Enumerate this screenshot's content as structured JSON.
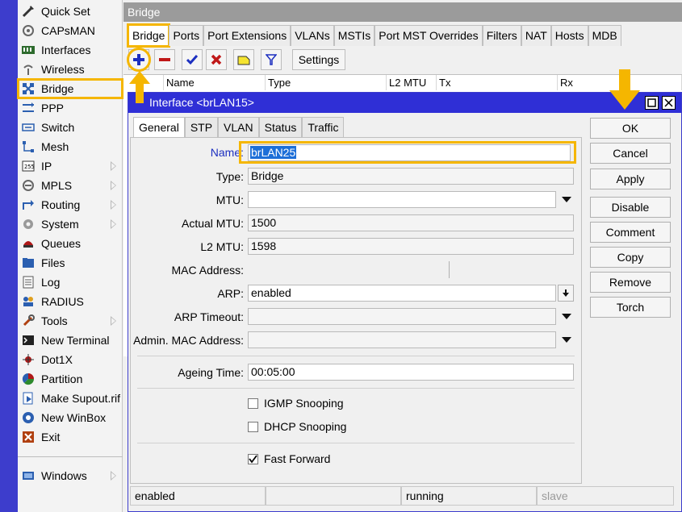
{
  "sidebar": {
    "items": [
      {
        "label": "Quick Set",
        "icon": "wand-icon",
        "submenu": false
      },
      {
        "label": "CAPsMAN",
        "icon": "capsman-icon",
        "submenu": false
      },
      {
        "label": "Interfaces",
        "icon": "interfaces-icon",
        "submenu": false
      },
      {
        "label": "Wireless",
        "icon": "wireless-icon",
        "submenu": false
      },
      {
        "label": "Bridge",
        "icon": "bridge-icon",
        "submenu": false,
        "selected": true
      },
      {
        "label": "PPP",
        "icon": "ppp-icon",
        "submenu": false
      },
      {
        "label": "Switch",
        "icon": "switch-icon",
        "submenu": false
      },
      {
        "label": "Mesh",
        "icon": "mesh-icon",
        "submenu": false
      },
      {
        "label": "IP",
        "icon": "ip-icon",
        "submenu": true
      },
      {
        "label": "MPLS",
        "icon": "mpls-icon",
        "submenu": true
      },
      {
        "label": "Routing",
        "icon": "routing-icon",
        "submenu": true
      },
      {
        "label": "System",
        "icon": "system-gear-icon",
        "submenu": true
      },
      {
        "label": "Queues",
        "icon": "queues-icon",
        "submenu": false
      },
      {
        "label": "Files",
        "icon": "folder-icon",
        "submenu": false
      },
      {
        "label": "Log",
        "icon": "log-icon",
        "submenu": false
      },
      {
        "label": "RADIUS",
        "icon": "radius-icon",
        "submenu": false
      },
      {
        "label": "Tools",
        "icon": "tools-icon",
        "submenu": true
      },
      {
        "label": "New Terminal",
        "icon": "terminal-icon",
        "submenu": false
      },
      {
        "label": "Dot1X",
        "icon": "dot1x-icon",
        "submenu": false
      },
      {
        "label": "Partition",
        "icon": "partition-icon",
        "submenu": false
      },
      {
        "label": "Make Supout.rif",
        "icon": "supout-icon",
        "submenu": false
      },
      {
        "label": "New WinBox",
        "icon": "winbox-icon",
        "submenu": false
      },
      {
        "label": "Exit",
        "icon": "exit-icon",
        "submenu": false
      }
    ],
    "windows": {
      "label": "Windows",
      "icon": "windows-icon",
      "submenu": true
    }
  },
  "bridge_window": {
    "title": "Bridge",
    "tabs": [
      "Bridge",
      "Ports",
      "Port Extensions",
      "VLANs",
      "MSTIs",
      "Port MST Overrides",
      "Filters",
      "NAT",
      "Hosts",
      "MDB"
    ],
    "toolbar": {
      "settings_label": "Settings"
    },
    "columns": [
      "Name",
      "Type",
      "L2 MTU",
      "Tx",
      "Rx"
    ]
  },
  "dialog": {
    "title": "Interface <brLAN15>",
    "tabs": [
      "General",
      "STP",
      "VLAN",
      "Status",
      "Traffic"
    ],
    "fields": {
      "name_label": "Name:",
      "name_value": "brLAN25",
      "type_label": "Type:",
      "type_value": "Bridge",
      "mtu_label": "MTU:",
      "mtu_value": "",
      "actual_mtu_label": "Actual MTU:",
      "actual_mtu_value": "1500",
      "l2_mtu_label": "L2 MTU:",
      "l2_mtu_value": "1598",
      "mac_label": "MAC Address:",
      "mac_value": "",
      "arp_label": "ARP:",
      "arp_value": "enabled",
      "arp_timeout_label": "ARP Timeout:",
      "arp_timeout_value": "",
      "admin_mac_label": "Admin. MAC Address:",
      "admin_mac_value": "",
      "ageing_label": "Ageing Time:",
      "ageing_value": "00:05:00"
    },
    "checkboxes": {
      "igmp": {
        "label": "IGMP Snooping",
        "checked": false
      },
      "dhcp": {
        "label": "DHCP Snooping",
        "checked": false
      },
      "fast_forward": {
        "label": "Fast Forward",
        "checked": true
      }
    },
    "buttons": {
      "ok": "OK",
      "cancel": "Cancel",
      "apply": "Apply",
      "disable": "Disable",
      "comment": "Comment",
      "copy": "Copy",
      "remove": "Remove",
      "torch": "Torch"
    },
    "status": [
      "enabled",
      "",
      "running",
      "slave"
    ]
  },
  "colors": {
    "highlight": "#f5b600",
    "title_active": "#2f2fd6",
    "title_inactive": "#9b9b9b",
    "side_strip": "#3d3dcc"
  }
}
